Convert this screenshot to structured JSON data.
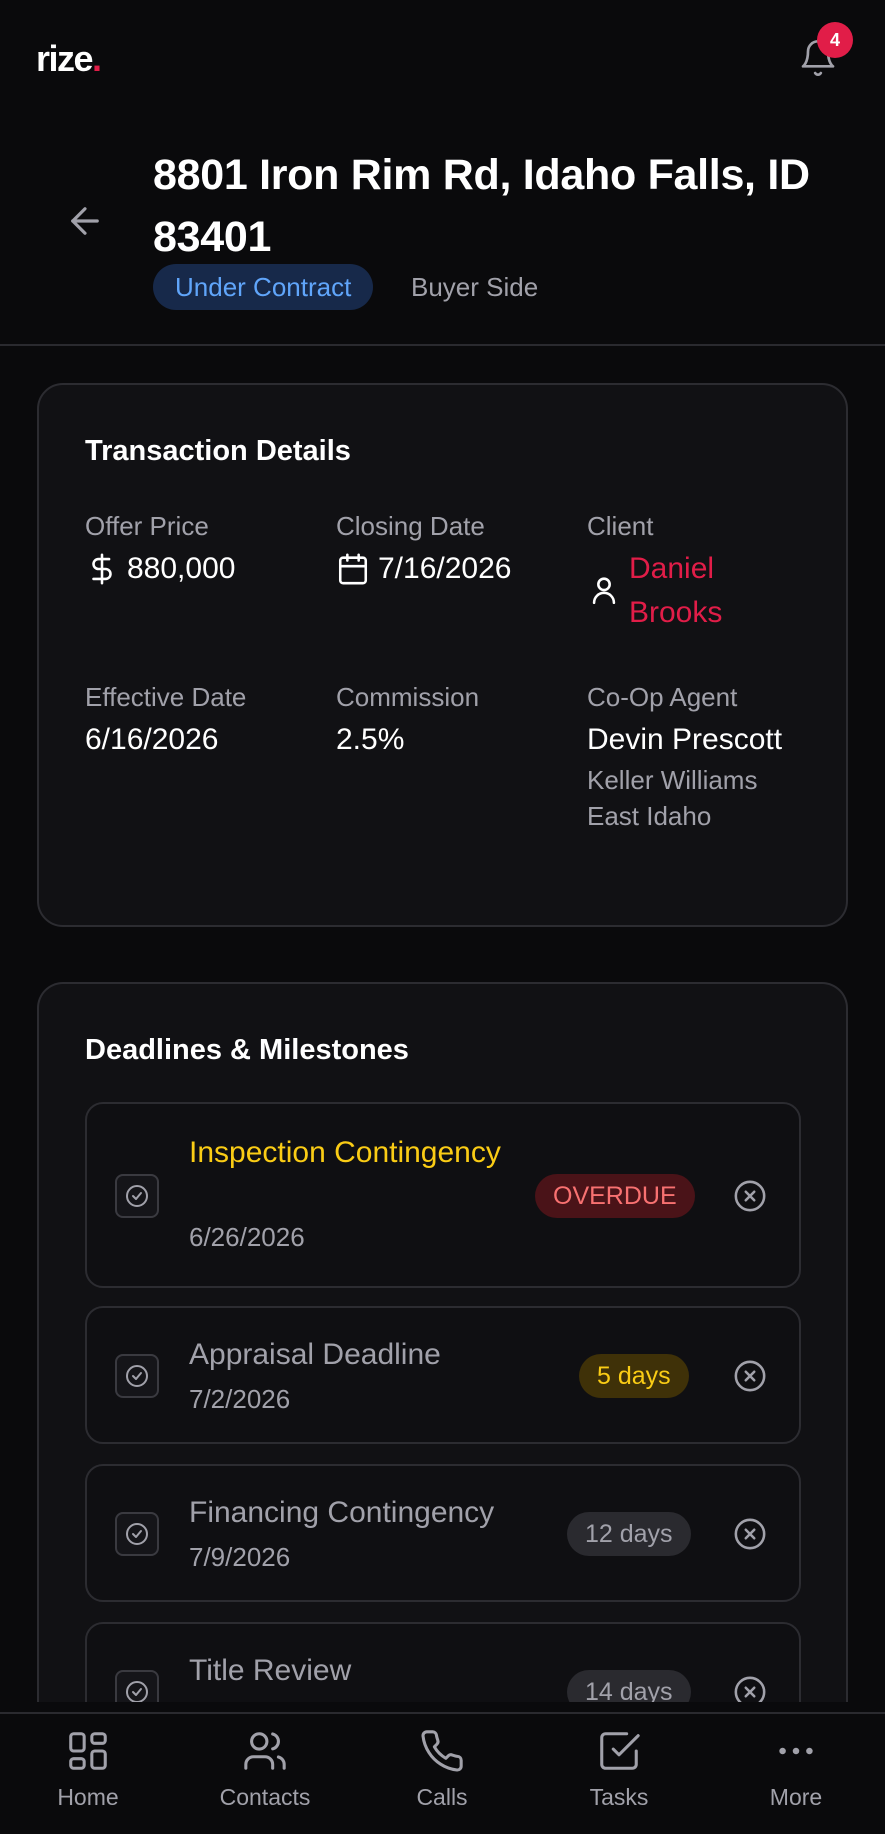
{
  "app": {
    "logo_text": "rize",
    "logo_dot": ".",
    "notification_count": "4",
    "brand_color": "#e11d48"
  },
  "header": {
    "address": "8801 Iron Rim Rd, Idaho Falls, ID 83401",
    "status": "Under Contract",
    "side": "Buyer Side"
  },
  "details": {
    "title": "Transaction Details",
    "offer_price_label": "Offer Price",
    "offer_price": "880,000",
    "closing_date_label": "Closing Date",
    "closing_date": "7/16/2026",
    "client_label": "Client",
    "client": "Daniel Brooks",
    "effective_date_label": "Effective Date",
    "effective_date": "6/16/2026",
    "commission_label": "Commission",
    "commission": "2.5%",
    "coop_label": "Co-Op Agent",
    "coop_agent": "Devin Prescott",
    "coop_brokerage": "Keller Williams East Idaho"
  },
  "deadlines": {
    "title": "Deadlines & Milestones",
    "items": [
      {
        "name": "Inspection Contingency",
        "date": "6/26/2026",
        "badge": "OVERDUE",
        "state": "overdue"
      },
      {
        "name": "Appraisal Deadline",
        "date": "7/2/2026",
        "badge": "5 days",
        "state": "soon"
      },
      {
        "name": "Financing Contingency",
        "date": "7/9/2026",
        "badge": "12 days",
        "state": "later"
      },
      {
        "name": "Title Review",
        "date": "",
        "badge": "14 days",
        "state": "later"
      }
    ]
  },
  "nav": {
    "items": [
      {
        "label": "Home",
        "icon": "grid-icon"
      },
      {
        "label": "Contacts",
        "icon": "users-icon"
      },
      {
        "label": "Calls",
        "icon": "phone-icon"
      },
      {
        "label": "Tasks",
        "icon": "check-square-icon"
      },
      {
        "label": "More",
        "icon": "more-horizontal-icon"
      }
    ]
  }
}
